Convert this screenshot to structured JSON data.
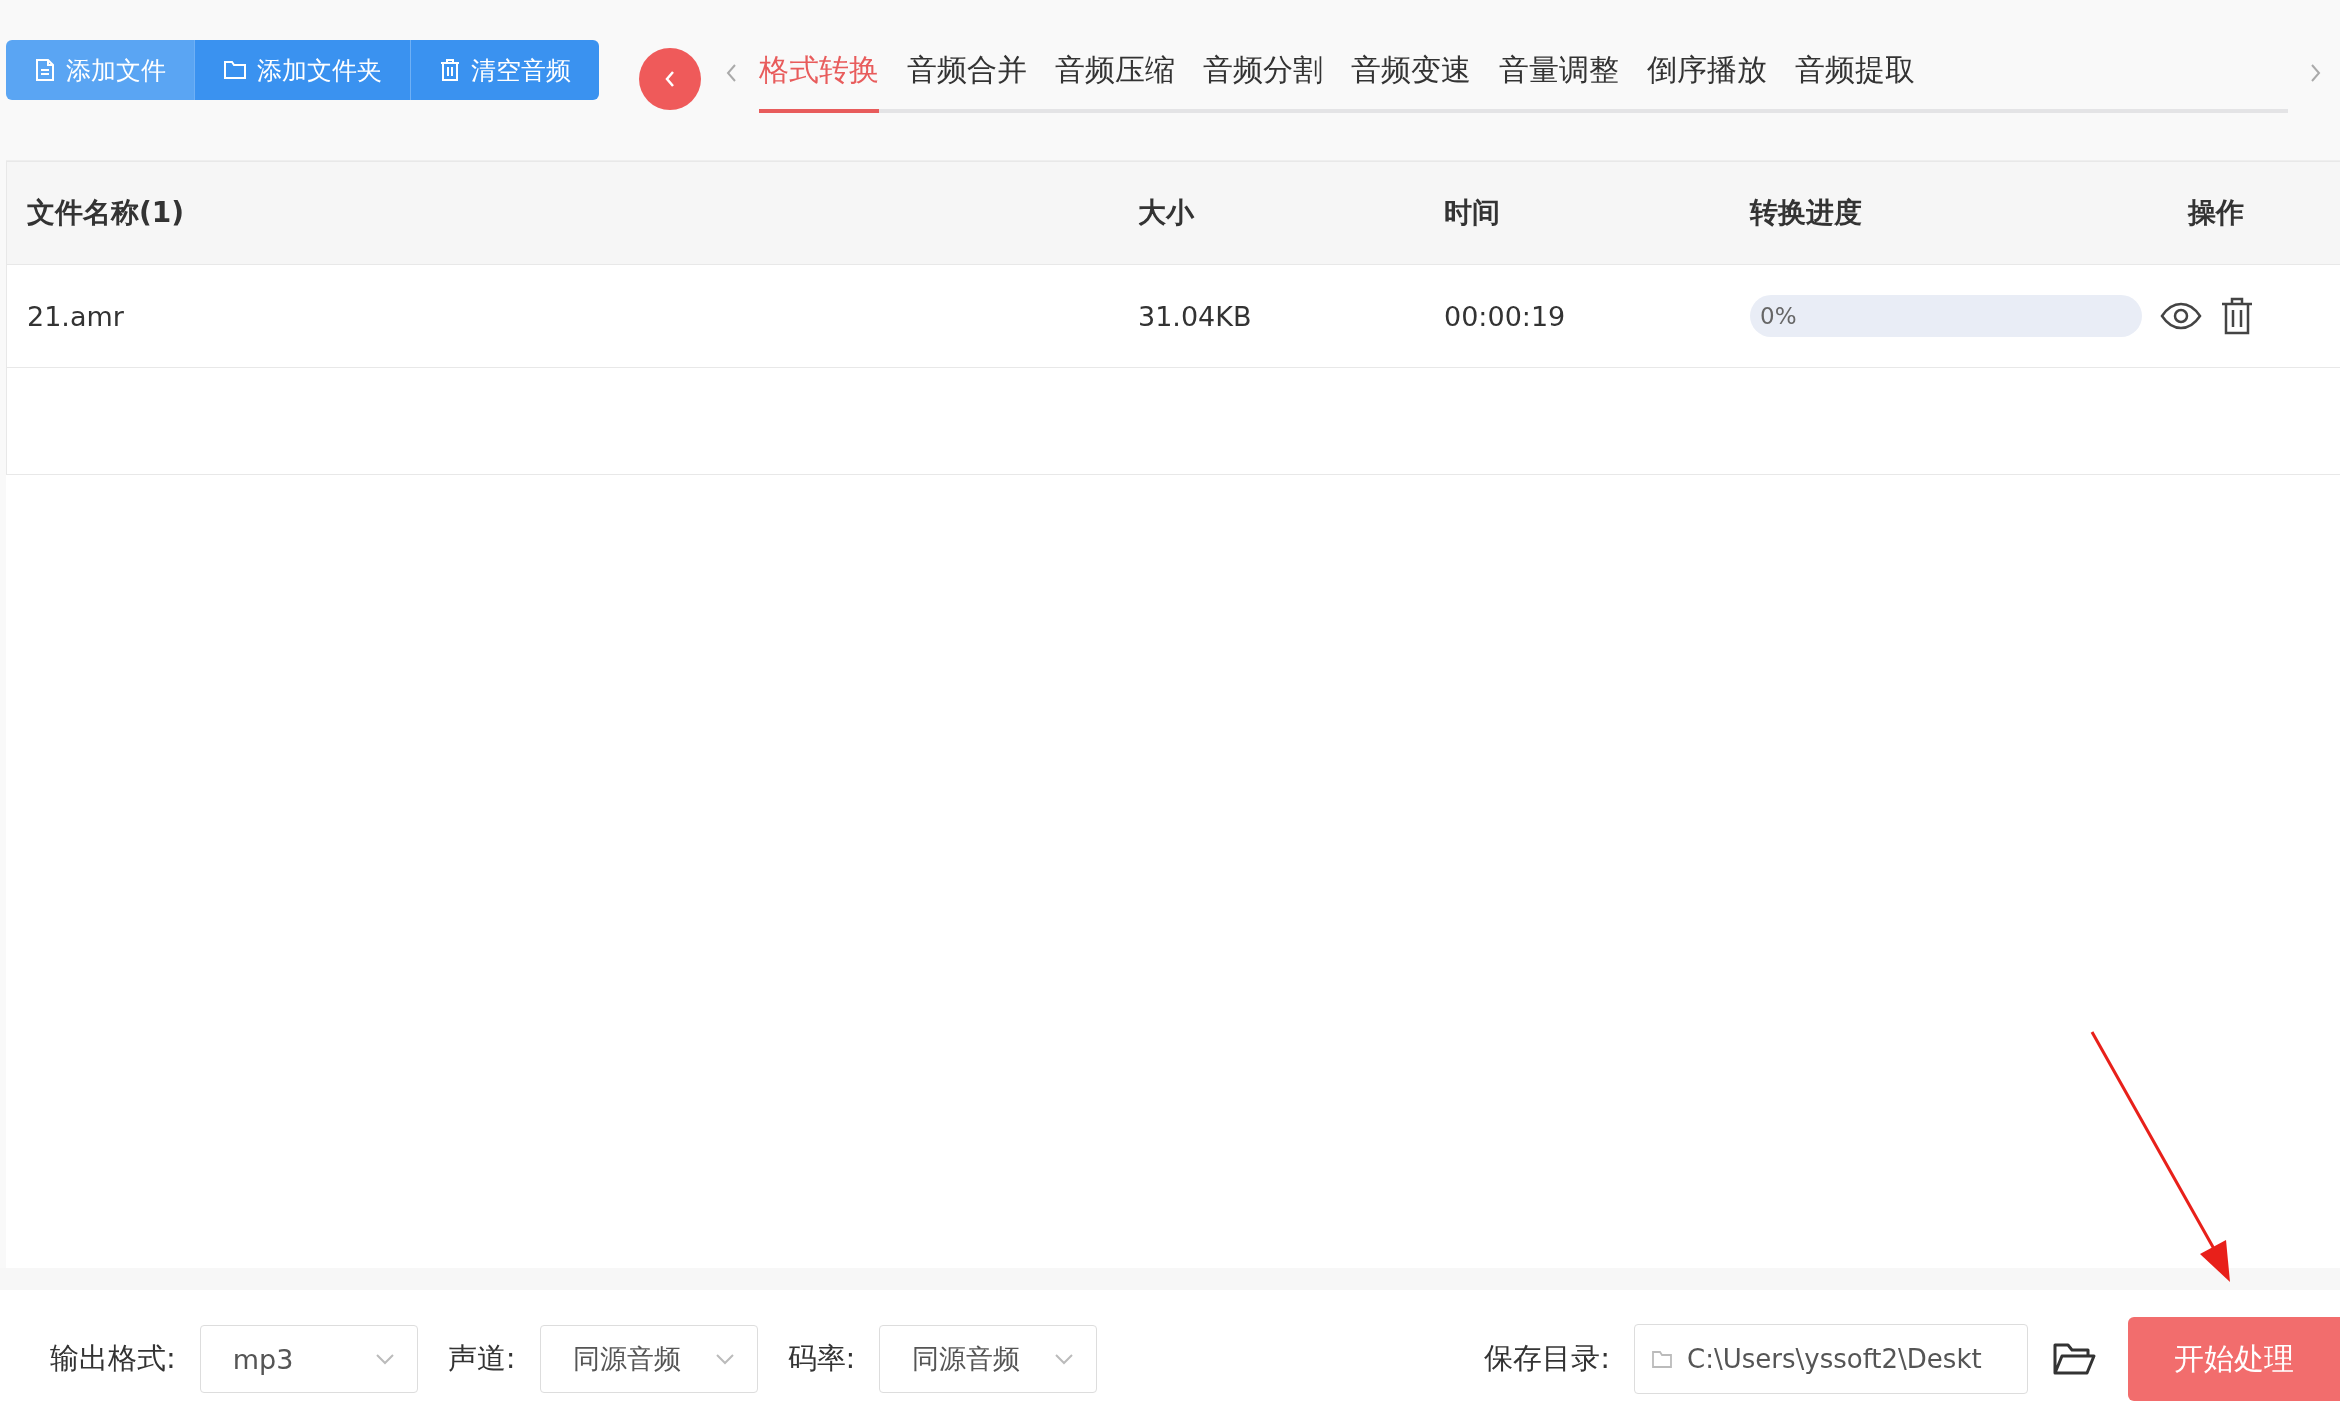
{
  "toolbar": [
    {
      "kind": "file",
      "label": "添加文件"
    },
    {
      "kind": "folder",
      "label": "添加文件夹"
    },
    {
      "kind": "trash",
      "label": "清空音频"
    }
  ],
  "tabs": [
    {
      "label": "格式转换",
      "selected": true
    },
    {
      "label": "音频合并",
      "selected": false
    },
    {
      "label": "音频压缩",
      "selected": false
    },
    {
      "label": "音频分割",
      "selected": false
    },
    {
      "label": "音频变速",
      "selected": false
    },
    {
      "label": "音量调整",
      "selected": false
    },
    {
      "label": "倒序播放",
      "selected": false
    },
    {
      "label": "音频提取",
      "selected": false
    }
  ],
  "table": {
    "columns": [
      "文件名称(1)",
      "大小",
      "时间",
      "转换进度",
      "操作"
    ],
    "rows": [
      {
        "name": "21.amr",
        "size": "31.04KB",
        "time": "00:00:19",
        "progress": {
          "level": 0,
          "reading": "0%"
        }
      }
    ]
  },
  "settings": [
    {
      "label": "输出格式:",
      "value": "mp3"
    },
    {
      "label": "声道:",
      "value": "同源音频"
    },
    {
      "label": "码率:",
      "value": "同源音频"
    }
  ],
  "save_dir": {
    "label": "保存目录:",
    "value": "C:\\Users\\yssoft2\\Deskt"
  },
  "start_button": "开始处理"
}
